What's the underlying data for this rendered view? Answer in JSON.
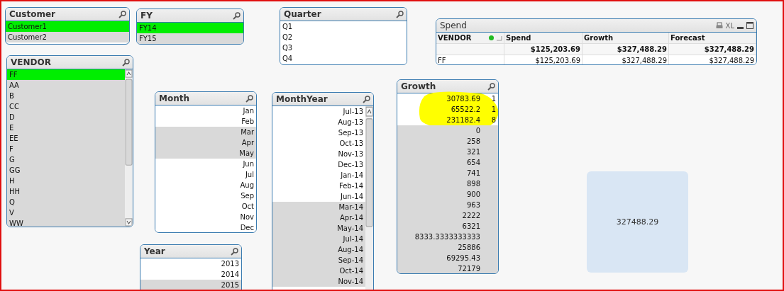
{
  "listboxes": [
    {
      "title": "Customer",
      "items": [
        {
          "label": "Customer1",
          "selected": true,
          "excluded": false
        },
        {
          "label": "Customer2",
          "selected": false,
          "excluded": true
        }
      ]
    },
    {
      "title": "FY",
      "items": [
        {
          "label": "FY14",
          "selected": true,
          "excluded": false
        },
        {
          "label": "FY15",
          "selected": false,
          "excluded": true
        }
      ]
    },
    {
      "title": "Quarter",
      "items": [
        {
          "label": "Q1",
          "selected": false,
          "excluded": false
        },
        {
          "label": "Q2",
          "selected": false,
          "excluded": false
        },
        {
          "label": "Q3",
          "selected": false,
          "excluded": false
        },
        {
          "label": "Q4",
          "selected": false,
          "excluded": false
        }
      ]
    },
    {
      "title": "VENDOR",
      "items": [
        {
          "label": "FF",
          "selected": true,
          "excluded": false
        },
        {
          "label": "AA",
          "selected": false,
          "excluded": true
        },
        {
          "label": "B",
          "selected": false,
          "excluded": true
        },
        {
          "label": "CC",
          "selected": false,
          "excluded": true
        },
        {
          "label": "D",
          "selected": false,
          "excluded": true
        },
        {
          "label": "E",
          "selected": false,
          "excluded": true
        },
        {
          "label": "EE",
          "selected": false,
          "excluded": true
        },
        {
          "label": "F",
          "selected": false,
          "excluded": true
        },
        {
          "label": "G",
          "selected": false,
          "excluded": true
        },
        {
          "label": "GG",
          "selected": false,
          "excluded": true
        },
        {
          "label": "H",
          "selected": false,
          "excluded": true
        },
        {
          "label": "HH",
          "selected": false,
          "excluded": true
        },
        {
          "label": "Q",
          "selected": false,
          "excluded": true
        },
        {
          "label": "V",
          "selected": false,
          "excluded": true
        },
        {
          "label": "WW",
          "selected": false,
          "excluded": true
        }
      ]
    },
    {
      "title": "Month",
      "items": [
        {
          "label": "Jan",
          "selected": false,
          "excluded": false
        },
        {
          "label": "Feb",
          "selected": false,
          "excluded": false
        },
        {
          "label": "Mar",
          "selected": false,
          "excluded": true
        },
        {
          "label": "Apr",
          "selected": false,
          "excluded": true
        },
        {
          "label": "May",
          "selected": false,
          "excluded": true
        },
        {
          "label": "Jun",
          "selected": false,
          "excluded": false
        },
        {
          "label": "Jul",
          "selected": false,
          "excluded": false
        },
        {
          "label": "Aug",
          "selected": false,
          "excluded": false
        },
        {
          "label": "Sep",
          "selected": false,
          "excluded": false
        },
        {
          "label": "Oct",
          "selected": false,
          "excluded": false
        },
        {
          "label": "Nov",
          "selected": false,
          "excluded": false
        },
        {
          "label": "Dec",
          "selected": false,
          "excluded": false
        }
      ]
    },
    {
      "title": "MonthYear",
      "items": [
        {
          "label": "Jul-13",
          "selected": false,
          "excluded": false
        },
        {
          "label": "Aug-13",
          "selected": false,
          "excluded": false
        },
        {
          "label": "Sep-13",
          "selected": false,
          "excluded": false
        },
        {
          "label": "Oct-13",
          "selected": false,
          "excluded": false
        },
        {
          "label": "Nov-13",
          "selected": false,
          "excluded": false
        },
        {
          "label": "Dec-13",
          "selected": false,
          "excluded": false
        },
        {
          "label": "Jan-14",
          "selected": false,
          "excluded": false
        },
        {
          "label": "Feb-14",
          "selected": false,
          "excluded": false
        },
        {
          "label": "Jun-14",
          "selected": false,
          "excluded": false
        },
        {
          "label": "Mar-14",
          "selected": false,
          "excluded": true
        },
        {
          "label": "Apr-14",
          "selected": false,
          "excluded": true
        },
        {
          "label": "May-14",
          "selected": false,
          "excluded": true
        },
        {
          "label": "Jul-14",
          "selected": false,
          "excluded": true
        },
        {
          "label": "Aug-14",
          "selected": false,
          "excluded": true
        },
        {
          "label": "Sep-14",
          "selected": false,
          "excluded": true
        },
        {
          "label": "Oct-14",
          "selected": false,
          "excluded": true
        },
        {
          "label": "Nov-14",
          "selected": false,
          "excluded": true
        }
      ]
    },
    {
      "title": "Growth",
      "items": [
        {
          "label": "30783.69",
          "count": "1",
          "selected": false,
          "excluded": false
        },
        {
          "label": "65522.2",
          "count": "1",
          "selected": false,
          "excluded": false
        },
        {
          "label": "231182.4",
          "count": "8",
          "selected": false,
          "excluded": false
        },
        {
          "label": "0",
          "selected": false,
          "excluded": true
        },
        {
          "label": "258",
          "selected": false,
          "excluded": true
        },
        {
          "label": "321",
          "selected": false,
          "excluded": true
        },
        {
          "label": "654",
          "selected": false,
          "excluded": true
        },
        {
          "label": "741",
          "selected": false,
          "excluded": true
        },
        {
          "label": "898",
          "selected": false,
          "excluded": true
        },
        {
          "label": "900",
          "selected": false,
          "excluded": true
        },
        {
          "label": "963",
          "selected": false,
          "excluded": true
        },
        {
          "label": "2222",
          "selected": false,
          "excluded": true
        },
        {
          "label": "6321",
          "selected": false,
          "excluded": true
        },
        {
          "label": "8333.3333333333",
          "selected": false,
          "excluded": true
        },
        {
          "label": "25886",
          "selected": false,
          "excluded": true
        },
        {
          "label": "69295.43",
          "selected": false,
          "excluded": true
        },
        {
          "label": "72179",
          "selected": false,
          "excluded": true
        }
      ]
    },
    {
      "title": "Year",
      "items": [
        {
          "label": "2013",
          "selected": false,
          "excluded": false
        },
        {
          "label": "2014",
          "selected": false,
          "excluded": false
        },
        {
          "label": "2015",
          "selected": false,
          "excluded": true
        }
      ]
    }
  ],
  "spend_table": {
    "title": "Spend",
    "export_label": "XL",
    "columns": [
      "VENDOR",
      "Spend",
      "Growth",
      "Forecast"
    ],
    "totals": [
      "$125,203.69",
      "$327,488.29",
      "$327,488.29"
    ],
    "rows": [
      [
        "FF",
        "$125,203.69",
        "$327,488.29",
        "$327,488.29"
      ]
    ]
  },
  "text_object": {
    "value": "327488.29"
  }
}
